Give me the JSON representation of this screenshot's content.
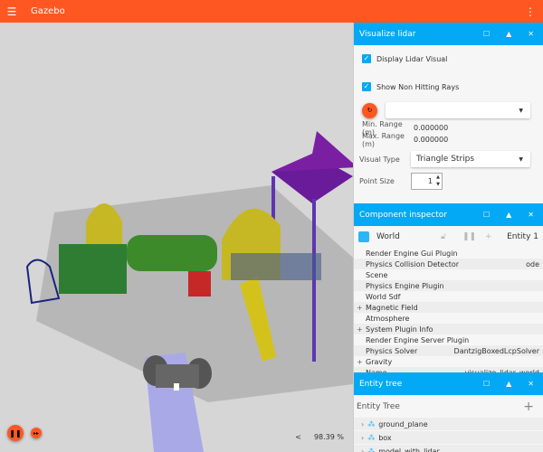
{
  "app": {
    "title": "Gazebo",
    "menu_icon": "hamburger-icon",
    "more_icon": "vertical-dots-icon"
  },
  "viewport": {
    "real_time_factor": "98.39 %",
    "rtf_toggle": "<"
  },
  "lidar": {
    "title": "Visualize lidar",
    "display_visual": {
      "label": "Display Lidar Visual",
      "checked": true
    },
    "non_hitting": {
      "label": "Show Non Hitting Rays",
      "checked": true
    },
    "topic_value": "",
    "min_range_label": "Min. Range (m)",
    "min_range": "0.000000",
    "max_range_label": "Max. Range (m)",
    "max_range": "0.000000",
    "visual_type_label": "Visual Type",
    "visual_type": "Triangle Strips",
    "point_size_label": "Point Size",
    "point_size": "1"
  },
  "inspector": {
    "title": "Component inspector",
    "entity_name": "World",
    "entity_id": "Entity 1",
    "rows": [
      {
        "name": "Render Engine Gui Plugin",
        "value": "",
        "expandable": false
      },
      {
        "name": "Physics Collision Detector",
        "value": "ode",
        "expandable": false
      },
      {
        "name": "Scene",
        "value": "",
        "expandable": false
      },
      {
        "name": "Physics Engine Plugin",
        "value": "",
        "expandable": false
      },
      {
        "name": "World Sdf",
        "value": "",
        "expandable": false
      },
      {
        "name": "Magnetic Field",
        "value": "",
        "expandable": true
      },
      {
        "name": "Atmosphere",
        "value": "",
        "expandable": false
      },
      {
        "name": "System Plugin Info",
        "value": "",
        "expandable": true
      },
      {
        "name": "Render Engine Server Plugin",
        "value": "",
        "expandable": false
      },
      {
        "name": "Physics Solver",
        "value": "DantzigBoxedLcpSolver",
        "expandable": false
      },
      {
        "name": "Gravity",
        "value": "",
        "expandable": true
      },
      {
        "name": "Name",
        "value": "visualize_lidar_world",
        "expandable": false
      }
    ]
  },
  "entity_tree": {
    "title": "Entity tree",
    "header": "Entity Tree",
    "add": "+",
    "items": [
      "ground_plane",
      "box",
      "model_with_lidar"
    ]
  },
  "colors": {
    "accent": "#ff5722",
    "panel_header": "#03a9f4"
  }
}
